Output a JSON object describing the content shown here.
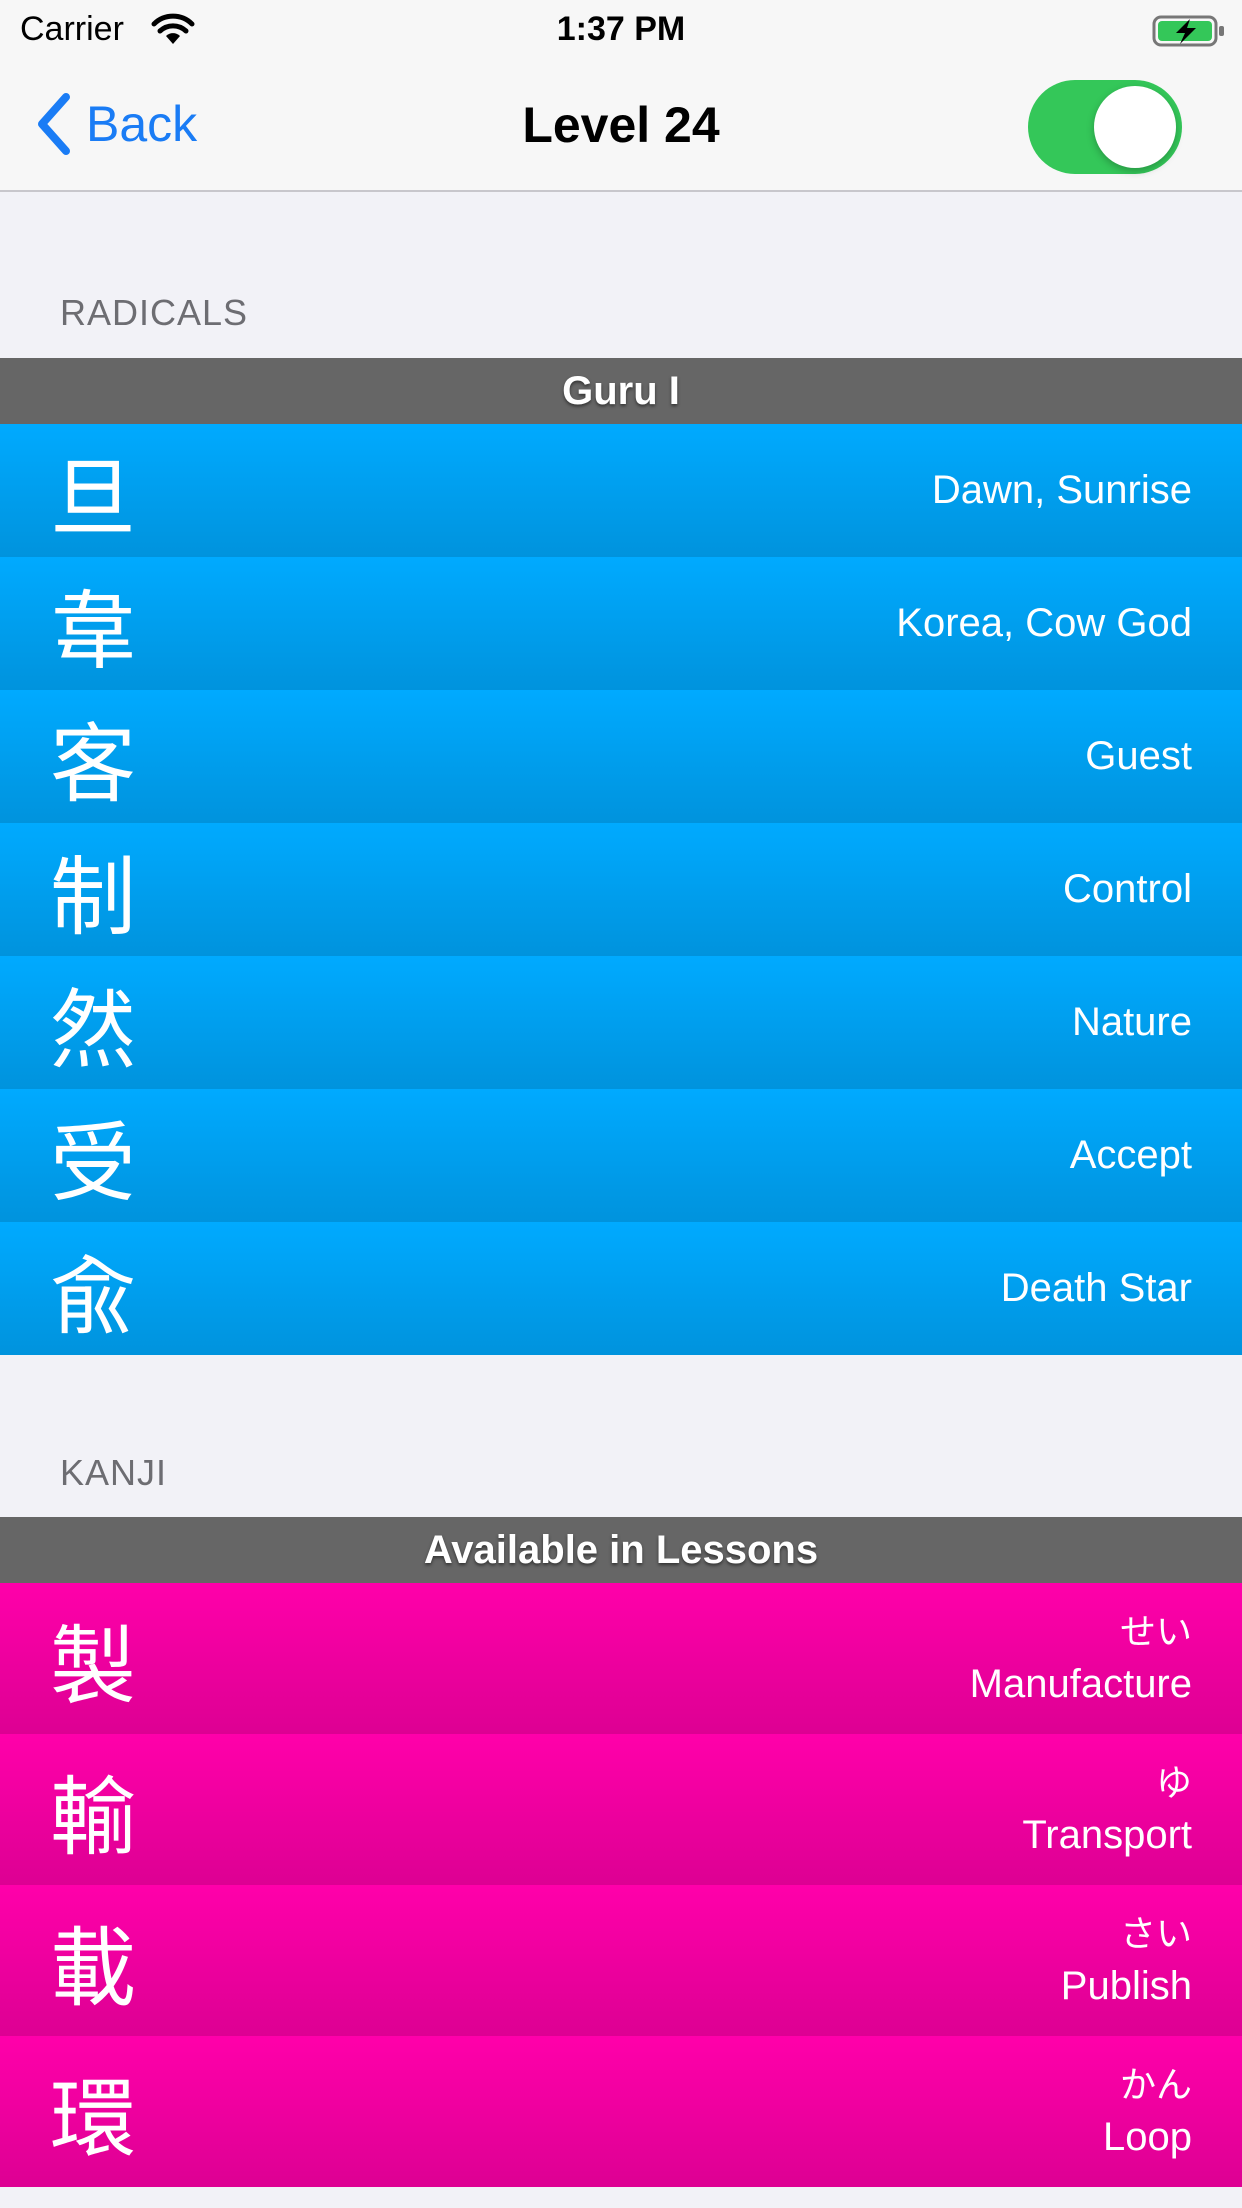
{
  "status_bar": {
    "carrier": "Carrier",
    "time": "1:37 PM",
    "wifi_icon": "wifi-icon",
    "battery_icon": "battery-charging-icon"
  },
  "nav": {
    "back_label": "Back",
    "title": "Level 24",
    "toggle_on": true,
    "accent_color": "#1a7cf5",
    "toggle_color": "#34c759"
  },
  "radicals": {
    "section_label": "RADICALS",
    "group_header": "Guru I",
    "row_color": "#00aaff",
    "items": [
      {
        "char": "旦",
        "meaning": "Dawn, Sunrise"
      },
      {
        "char": "韋",
        "meaning": "Korea, Cow God"
      },
      {
        "char": "客",
        "meaning": "Guest"
      },
      {
        "char": "制",
        "meaning": "Control"
      },
      {
        "char": "然",
        "meaning": "Nature"
      },
      {
        "char": "受",
        "meaning": "Accept"
      },
      {
        "char": "兪",
        "meaning": "Death Star"
      }
    ]
  },
  "kanji": {
    "section_label": "KANJI",
    "group_header": "Available in Lessons",
    "row_color": "#ff00aa",
    "items": [
      {
        "char": "製",
        "reading": "せい",
        "meaning": "Manufacture"
      },
      {
        "char": "輸",
        "reading": "ゆ",
        "meaning": "Transport"
      },
      {
        "char": "載",
        "reading": "さい",
        "meaning": "Publish"
      },
      {
        "char": "環",
        "reading": "かん",
        "meaning": "Loop"
      }
    ]
  }
}
